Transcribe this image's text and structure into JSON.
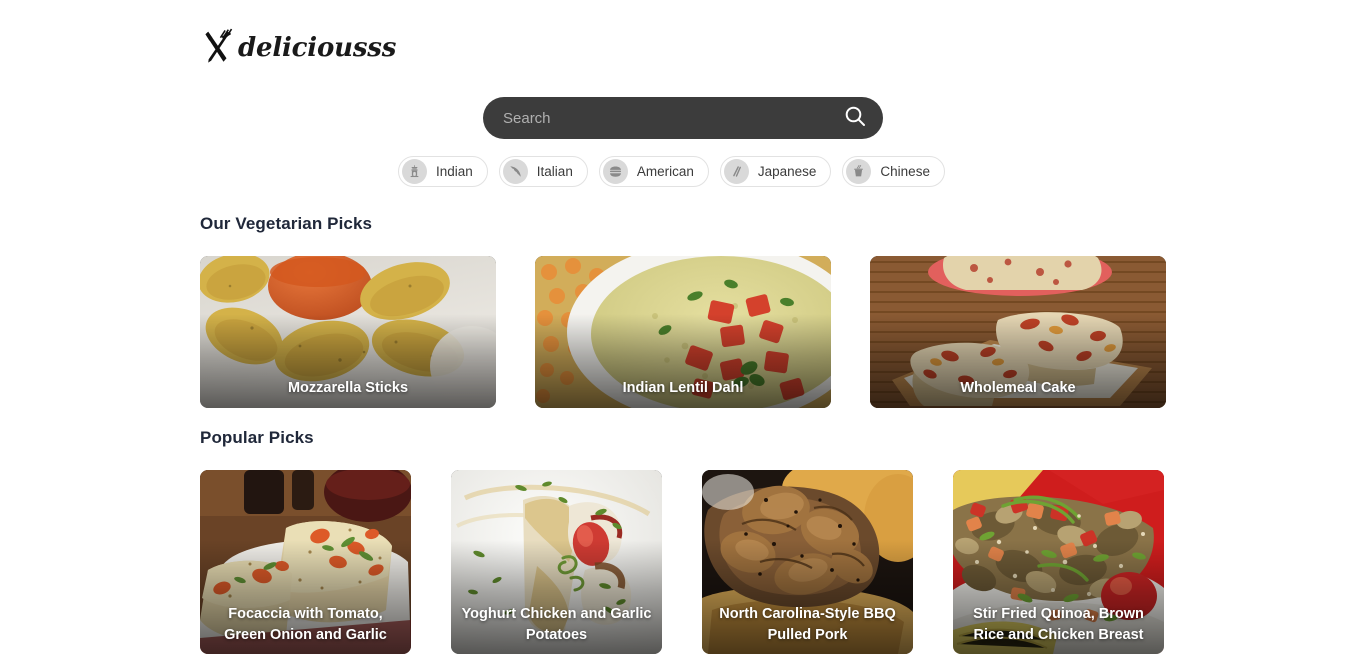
{
  "brand": {
    "name": "deliciousss",
    "icon": "crossed-fork-knife-icon"
  },
  "search": {
    "placeholder": "Search",
    "value": "",
    "icon": "search-icon"
  },
  "cuisine_filters": [
    {
      "label": "Indian",
      "icon": "india-gate-monument-icon"
    },
    {
      "label": "Italian",
      "icon": "pizza-slice-icon"
    },
    {
      "label": "American",
      "icon": "burger-icon"
    },
    {
      "label": "Japanese",
      "icon": "chopsticks-icon"
    },
    {
      "label": "Chinese",
      "icon": "takeout-box-icon"
    }
  ],
  "sections": [
    {
      "title": "Our Vegetarian Picks",
      "cards": [
        {
          "title": "Mozzarella Sticks"
        },
        {
          "title": "Indian Lentil Dahl"
        },
        {
          "title": "Wholemeal Cake"
        }
      ]
    },
    {
      "title": "Popular Picks",
      "cards": [
        {
          "title": "Focaccia with Tomato, Green Onion and Garlic"
        },
        {
          "title": "Yoghurt Chicken and Garlic Potatoes"
        },
        {
          "title": "North Carolina-Style BBQ Pulled Pork"
        },
        {
          "title": "Stir Fried Quinoa, Brown Rice and Chicken Breast"
        }
      ]
    }
  ],
  "colors": {
    "page_background": "#ffffff",
    "search_background": "#3c3c3c",
    "search_placeholder": "#b0b0b0",
    "chip_border": "#e2e2e2",
    "chip_badge": "#d9d9d9",
    "chip_label": "#3b3b3b",
    "heading": "#20283a",
    "card_caption": "#ffffff"
  }
}
